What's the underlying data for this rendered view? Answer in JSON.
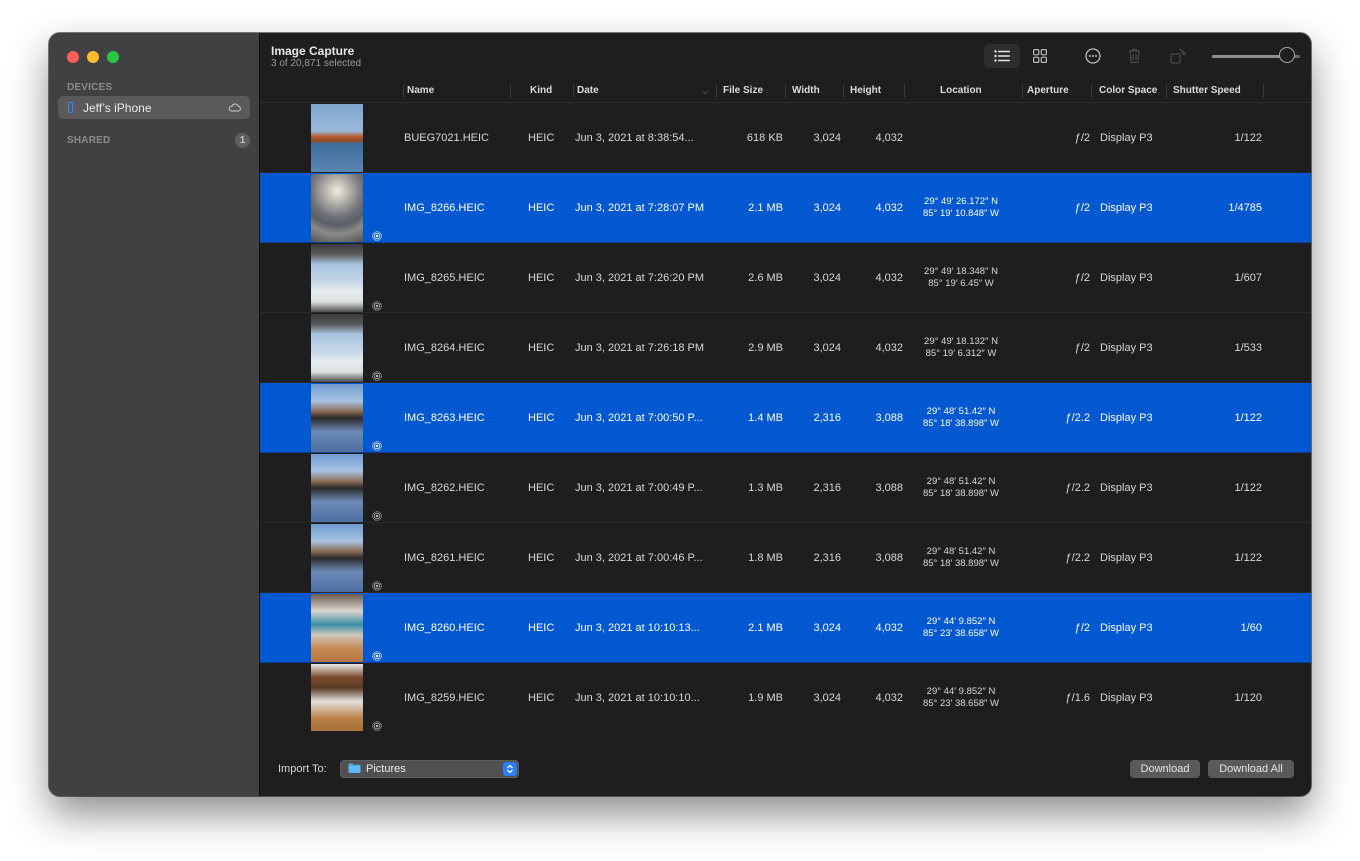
{
  "app": {
    "title": "Image Capture",
    "subtitle": "3 of 20,871 selected"
  },
  "sidebar": {
    "devices_header": "DEVICES",
    "device": {
      "label": "Jeff’s iPhone",
      "icon": "iphone-icon",
      "status_icon": "cloud-icon"
    },
    "shared_header": "SHARED",
    "shared_count": "1"
  },
  "toolbar": {
    "list_view": "list-view-icon",
    "grid_view": "grid-view-icon",
    "more": "more-options-icon",
    "delete": "trash-icon",
    "rotate": "rotate-icon",
    "thumbnail_size": 0.85
  },
  "table": {
    "columns": [
      "Name",
      "Kind",
      "Date",
      "File Size",
      "Width",
      "Height",
      "Location",
      "Aperture",
      "Color Space",
      "Shutter Speed"
    ],
    "sort_column": "Date",
    "sort_direction": "descending",
    "rows": [
      {
        "name": "BUEG7021.HEIC",
        "kind": "HEIC",
        "date": "Jun 3, 2021 at 8:38:54...",
        "size": "618 KB",
        "width": "3,024",
        "height": "4,032",
        "lat": "",
        "lon": "",
        "aperture": "ƒ/2",
        "color_space": "Display P3",
        "shutter": "1/122",
        "selected": false,
        "live": false,
        "thumb": "harbor"
      },
      {
        "name": "IMG_8266.HEIC",
        "kind": "HEIC",
        "date": "Jun 3, 2021 at 7:28:07 PM",
        "size": "2.1 MB",
        "width": "3,024",
        "height": "4,032",
        "lat": "29° 49′ 26.172″ N",
        "lon": "85° 19′ 10.848″ W",
        "aperture": "ƒ/2",
        "color_space": "Display P3",
        "shutter": "1/4785",
        "selected": true,
        "live": true,
        "thumb": "sunset"
      },
      {
        "name": "IMG_8265.HEIC",
        "kind": "HEIC",
        "date": "Jun 3, 2021 at 7:26:20 PM",
        "size": "2.6 MB",
        "width": "3,024",
        "height": "4,032",
        "lat": "29° 49′ 18.348″ N",
        "lon": "85° 19′ 6.45″ W",
        "aperture": "ƒ/2",
        "color_space": "Display P3",
        "shutter": "1/607",
        "selected": false,
        "live": true,
        "thumb": "boat"
      },
      {
        "name": "IMG_8264.HEIC",
        "kind": "HEIC",
        "date": "Jun 3, 2021 at 7:26:18 PM",
        "size": "2.9 MB",
        "width": "3,024",
        "height": "4,032",
        "lat": "29° 49′ 18.132″ N",
        "lon": "85° 19′ 6.312″ W",
        "aperture": "ƒ/2",
        "color_space": "Display P3",
        "shutter": "1/533",
        "selected": false,
        "live": true,
        "thumb": "boat"
      },
      {
        "name": "IMG_8263.HEIC",
        "kind": "HEIC",
        "date": "Jun 3, 2021 at 7:00:50 P...",
        "size": "1.4 MB",
        "width": "2,316",
        "height": "3,088",
        "lat": "29° 48′ 51.42″ N",
        "lon": "85° 18′ 38.898″ W",
        "aperture": "ƒ/2.2",
        "color_space": "Display P3",
        "shutter": "1/122",
        "selected": true,
        "live": true,
        "thumb": "selfie"
      },
      {
        "name": "IMG_8262.HEIC",
        "kind": "HEIC",
        "date": "Jun 3, 2021 at 7:00:49 P...",
        "size": "1.3 MB",
        "width": "2,316",
        "height": "3,088",
        "lat": "29° 48′ 51.42″ N",
        "lon": "85° 18′ 38.898″ W",
        "aperture": "ƒ/2.2",
        "color_space": "Display P3",
        "shutter": "1/122",
        "selected": false,
        "live": true,
        "thumb": "selfie"
      },
      {
        "name": "IMG_8261.HEIC",
        "kind": "HEIC",
        "date": "Jun 3, 2021 at 7:00:46 P...",
        "size": "1.8 MB",
        "width": "2,316",
        "height": "3,088",
        "lat": "29° 48′ 51.42″ N",
        "lon": "85° 18′ 38.898″ W",
        "aperture": "ƒ/2.2",
        "color_space": "Display P3",
        "shutter": "1/122",
        "selected": false,
        "live": true,
        "thumb": "selfie"
      },
      {
        "name": "IMG_8260.HEIC",
        "kind": "HEIC",
        "date": "Jun 3, 2021 at 10:10:13...",
        "size": "2.1 MB",
        "width": "3,024",
        "height": "4,032",
        "lat": "29° 44′ 9.852″ N",
        "lon": "85° 23′ 38.658″ W",
        "aperture": "ƒ/2",
        "color_space": "Display P3",
        "shutter": "1/60",
        "selected": true,
        "live": true,
        "thumb": "interior"
      },
      {
        "name": "IMG_8259.HEIC",
        "kind": "HEIC",
        "date": "Jun 3, 2021 at 10:10:10...",
        "size": "1.9 MB",
        "width": "3,024",
        "height": "4,032",
        "lat": "29° 44′ 9.852″ N",
        "lon": "85° 23′ 38.658″ W",
        "aperture": "ƒ/1.6",
        "color_space": "Display P3",
        "shutter": "1/120",
        "selected": false,
        "live": true,
        "thumb": "kitchen"
      }
    ]
  },
  "footer": {
    "import_label": "Import To:",
    "import_destination": "Pictures",
    "download_label": "Download",
    "download_all_label": "Download All"
  },
  "colors": {
    "selection": "#0158d0",
    "background": "#1e1e20",
    "sidebar": "#414143",
    "accent": "#2f7ff0"
  }
}
